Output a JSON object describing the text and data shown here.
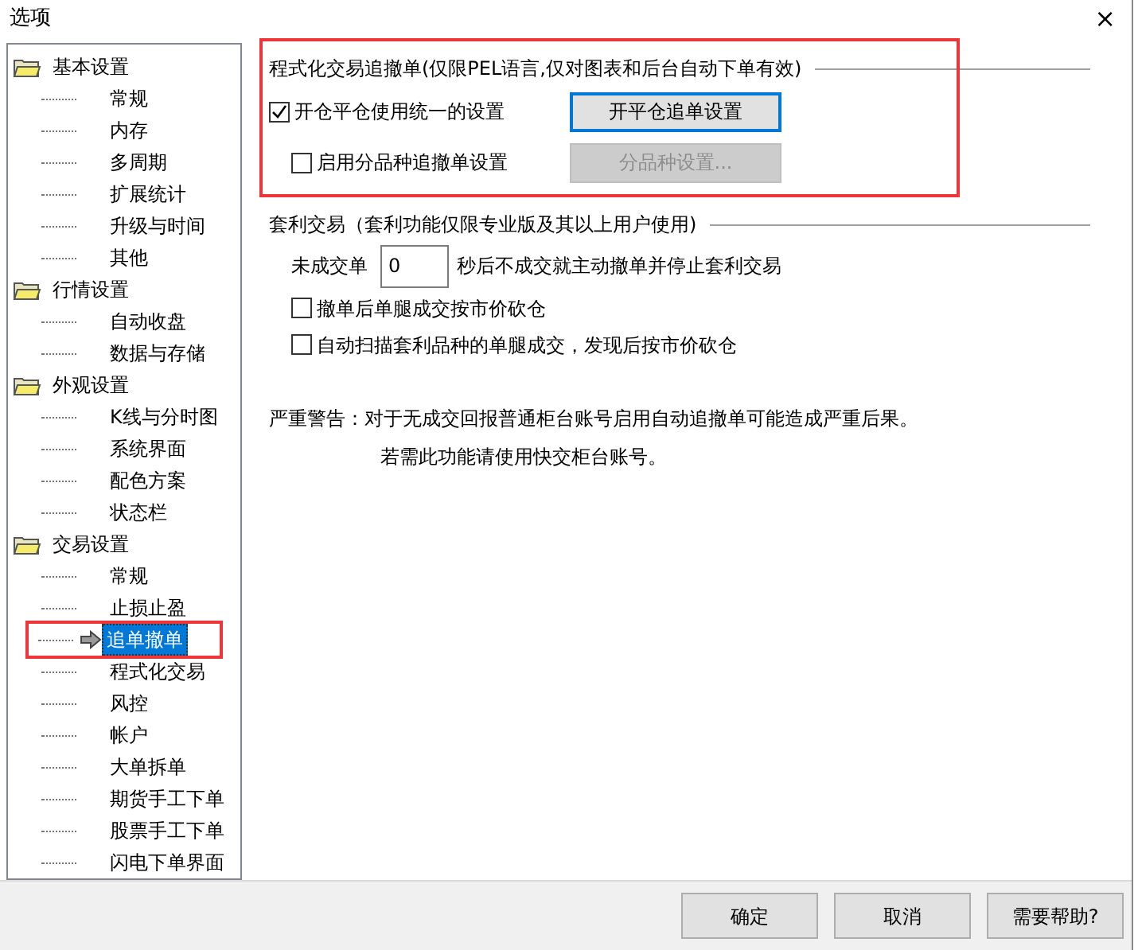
{
  "window": {
    "title": "选项",
    "close": "×"
  },
  "tree": [
    {
      "label": "基本设置",
      "expanded": true,
      "children": [
        {
          "label": "常规",
          "selected": false,
          "annotated": false
        },
        {
          "label": "内存",
          "selected": false,
          "annotated": false
        },
        {
          "label": "多周期",
          "selected": false,
          "annotated": false
        },
        {
          "label": "扩展统计",
          "selected": false,
          "annotated": false
        },
        {
          "label": "升级与时间",
          "selected": false,
          "annotated": false
        },
        {
          "label": "其他",
          "selected": false,
          "annotated": false
        }
      ]
    },
    {
      "label": "行情设置",
      "expanded": true,
      "children": [
        {
          "label": "自动收盘",
          "selected": false,
          "annotated": false
        },
        {
          "label": "数据与存储",
          "selected": false,
          "annotated": false
        }
      ]
    },
    {
      "label": "外观设置",
      "expanded": true,
      "children": [
        {
          "label": "K线与分时图",
          "selected": false,
          "annotated": false
        },
        {
          "label": "系统界面",
          "selected": false,
          "annotated": false
        },
        {
          "label": "配色方案",
          "selected": false,
          "annotated": false
        },
        {
          "label": "状态栏",
          "selected": false,
          "annotated": false
        }
      ]
    },
    {
      "label": "交易设置",
      "expanded": true,
      "children": [
        {
          "label": "常规",
          "selected": false,
          "annotated": false
        },
        {
          "label": "止损止盈",
          "selected": false,
          "annotated": false
        },
        {
          "label": "追单撤单",
          "selected": true,
          "annotated": true
        },
        {
          "label": "程式化交易",
          "selected": false,
          "annotated": false
        },
        {
          "label": "风控",
          "selected": false,
          "annotated": false
        },
        {
          "label": "帐户",
          "selected": false,
          "annotated": false
        },
        {
          "label": "大单拆单",
          "selected": false,
          "annotated": false
        },
        {
          "label": "期货手工下单",
          "selected": false,
          "annotated": false
        },
        {
          "label": "股票手工下单",
          "selected": false,
          "annotated": false
        },
        {
          "label": "闪电下单界面",
          "selected": false,
          "annotated": false
        }
      ]
    }
  ],
  "program_section": {
    "title": "程式化交易追撤单(仅限PEL语言,仅对图表和后台自动下单有效)",
    "annotated": true,
    "rows": [
      {
        "checkbox": {
          "label": "开仓平仓使用统一的设置",
          "checked": true
        },
        "button": {
          "label": "开平仓追单设置",
          "disabled": false,
          "focused": true
        }
      },
      {
        "checkbox": {
          "label": "启用分品种追撤单设置",
          "checked": false
        },
        "button": {
          "label": "分品种设置...",
          "disabled": true,
          "focused": false
        }
      }
    ]
  },
  "arbitrage_section": {
    "title": "套利交易（套利功能仅限专业版及其以上用户使用)",
    "timeout": {
      "label": "未成交单",
      "value": "0",
      "suffix": "秒后不成交就主动撤单并停止套利交易"
    },
    "options": [
      {
        "label": "撤单后单腿成交按市价砍仓",
        "checked": false
      },
      {
        "label": "自动扫描套利品种的单腿成交，发现后按市价砍仓",
        "checked": false
      }
    ]
  },
  "warning": {
    "line_1": "严重警告：对于无成交回报普通柜台账号启用自动追撤单可能造成严重后果。",
    "line_2": "若需此功能请使用快交柜台账号。"
  },
  "buttons": [
    {
      "label": "确定"
    },
    {
      "label": "取消"
    },
    {
      "label": "需要帮助?"
    }
  ]
}
